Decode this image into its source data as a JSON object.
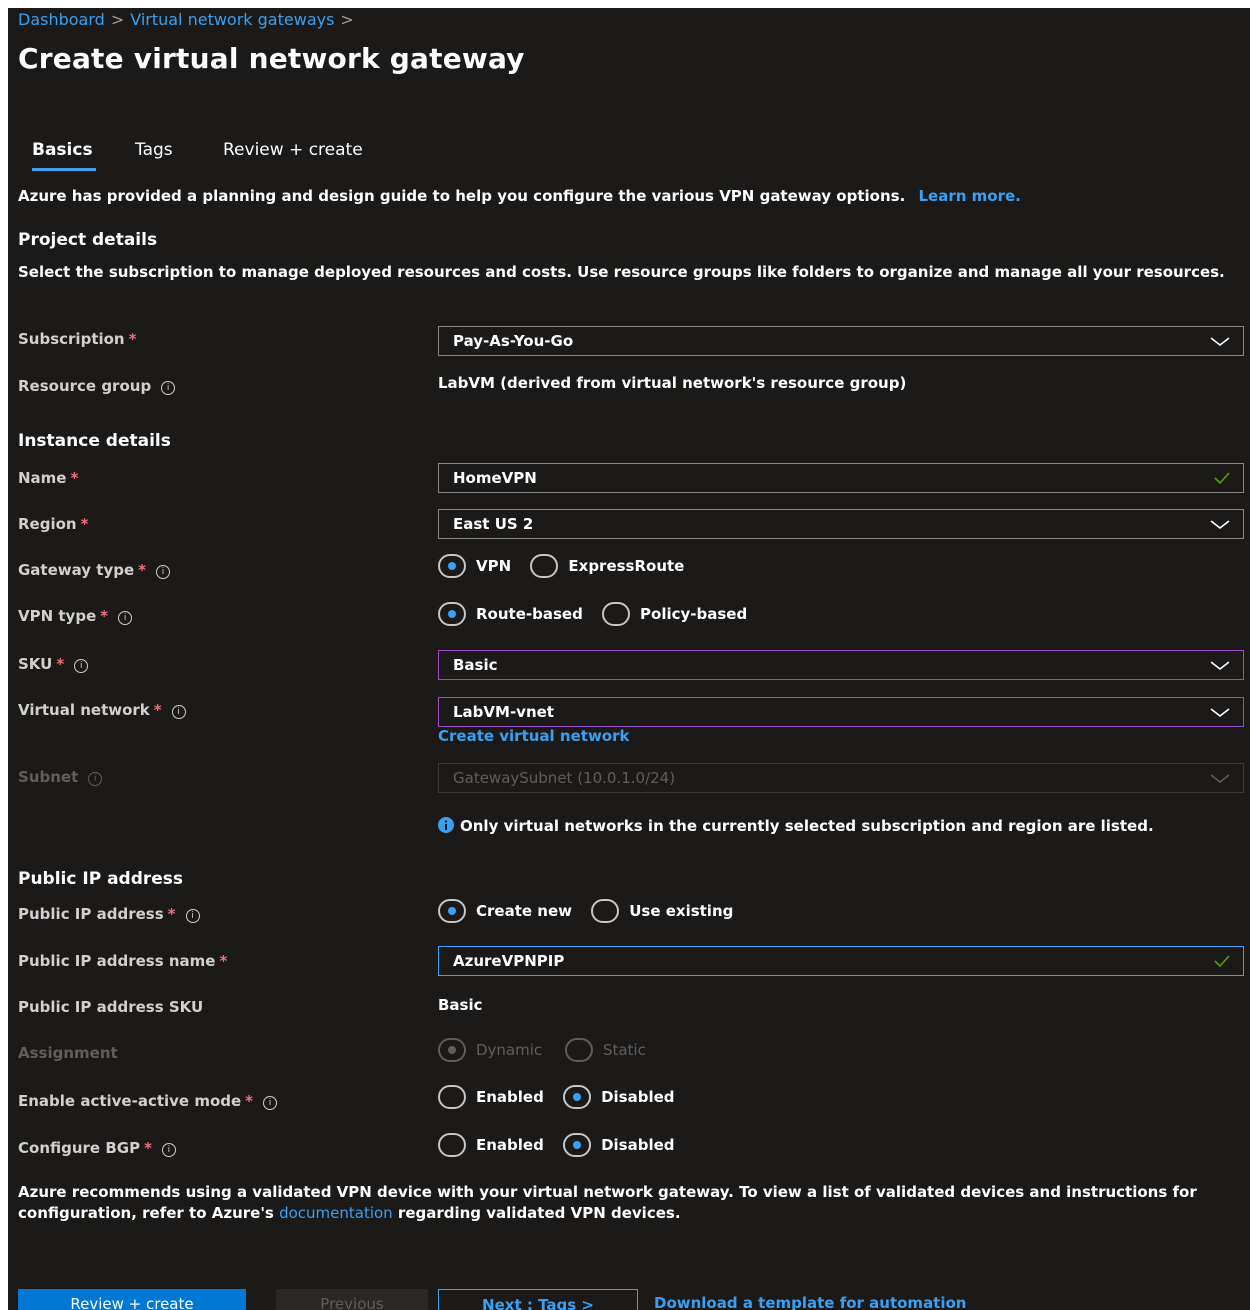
{
  "breadcrumb": {
    "items": [
      "Dashboard",
      "Virtual network gateways"
    ],
    "separator": ">"
  },
  "page_title": "Create virtual network gateway",
  "tabs": [
    {
      "label": "Basics",
      "active": true
    },
    {
      "label": "Tags",
      "active": false
    },
    {
      "label": "Review + create",
      "active": false
    }
  ],
  "intro": {
    "text": "Azure has provided a planning and design guide to help you configure the various VPN gateway options.",
    "link": "Learn more."
  },
  "project_details": {
    "heading": "Project details",
    "description": "Select the subscription to manage deployed resources and costs. Use resource groups like folders to organize and manage all your resources.",
    "subscription": {
      "label": "Subscription",
      "value": "Pay-As-You-Go"
    },
    "resource_group": {
      "label": "Resource group",
      "value": "LabVM (derived from virtual network's resource group)"
    }
  },
  "instance_details": {
    "heading": "Instance details",
    "name": {
      "label": "Name",
      "value": "HomeVPN"
    },
    "region": {
      "label": "Region",
      "value": "East US 2"
    },
    "gateway_type": {
      "label": "Gateway type",
      "options": [
        "VPN",
        "ExpressRoute"
      ],
      "selected": "VPN"
    },
    "vpn_type": {
      "label": "VPN type",
      "options": [
        "Route-based",
        "Policy-based"
      ],
      "selected": "Route-based"
    },
    "sku": {
      "label": "SKU",
      "value": "Basic"
    },
    "virtual_network": {
      "label": "Virtual network",
      "value": "LabVM-vnet",
      "create_link": "Create virtual network"
    },
    "subnet": {
      "label": "Subnet",
      "value": "GatewaySubnet (10.0.1.0/24)"
    },
    "note": "Only virtual networks in the currently selected subscription and region are listed."
  },
  "public_ip": {
    "heading": "Public IP address",
    "address": {
      "label": "Public IP address",
      "options": [
        "Create new",
        "Use existing"
      ],
      "selected": "Create new"
    },
    "name": {
      "label": "Public IP address name",
      "value": "AzureVPNPIP"
    },
    "sku": {
      "label": "Public IP address SKU",
      "value": "Basic"
    },
    "assignment": {
      "label": "Assignment",
      "options": [
        "Dynamic",
        "Static"
      ],
      "selected": "Dynamic"
    },
    "active_active": {
      "label": "Enable active-active mode",
      "options": [
        "Enabled",
        "Disabled"
      ],
      "selected": "Disabled"
    },
    "bgp": {
      "label": "Configure BGP",
      "options": [
        "Enabled",
        "Disabled"
      ],
      "selected": "Disabled"
    }
  },
  "footer_note": {
    "text_before": "Azure recommends using a validated VPN device with your virtual network gateway. To view a list of validated devices and instructions for configuration, refer to Azure's",
    "link": "documentation",
    "text_after": "regarding validated VPN devices."
  },
  "buttons": {
    "review_create": "Review + create",
    "previous": "Previous",
    "next": "Next : Tags >",
    "download": "Download a template for automation"
  },
  "colors": {
    "background": "#1b1a19",
    "accent": "#3aa0f3",
    "required": "#f1707b",
    "focus_purple": "#9c4ac7",
    "primary_button": "#0078d4"
  }
}
